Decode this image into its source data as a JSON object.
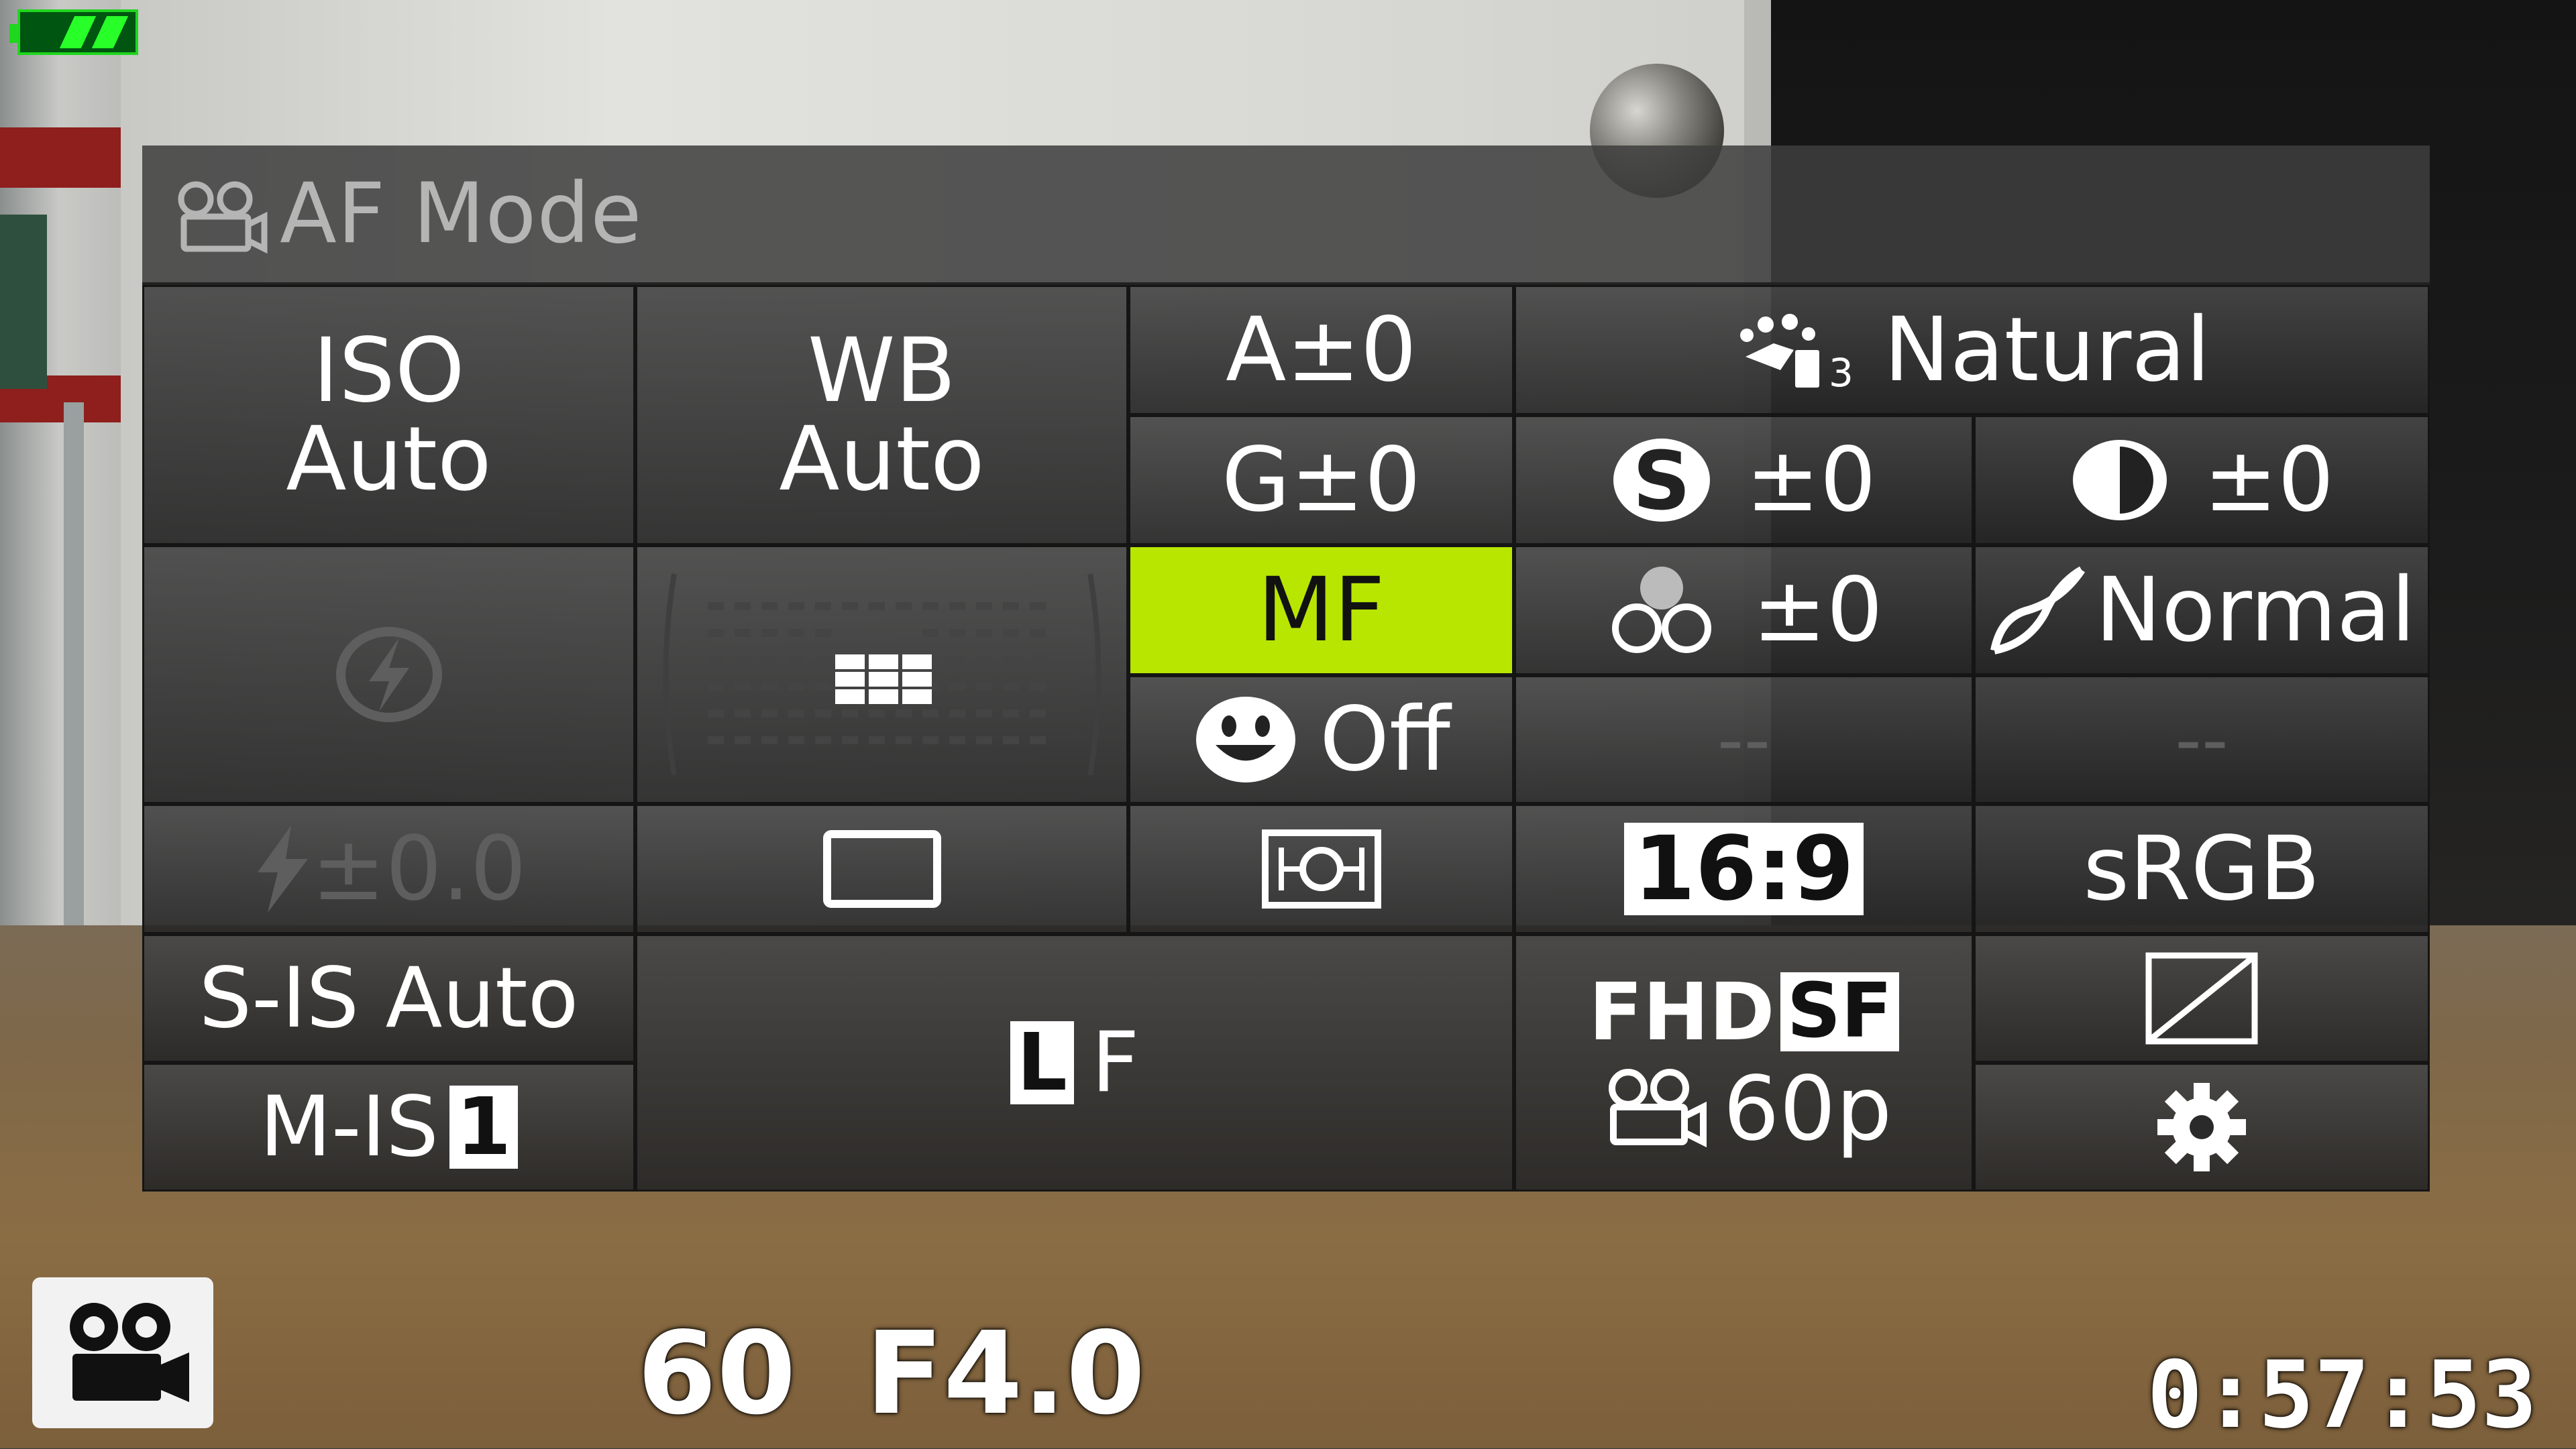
{
  "battery": {
    "level": 0.5,
    "color": "#1ed71e"
  },
  "panel": {
    "title": "AF Mode",
    "title_icon": "movie-camera-icon",
    "iso": {
      "line1": "ISO",
      "line2": "Auto"
    },
    "wb": {
      "line1": "WB",
      "line2": "Auto"
    },
    "wb_amber": "A±0",
    "wb_green": "G±0",
    "picture_mode": {
      "icon": "picture-mode-icon",
      "sub": "3",
      "label": "Natural"
    },
    "sharpness": "±0",
    "contrast": "±0",
    "saturation": "±0",
    "gradation": "Normal",
    "flash_mode_icon": "flash-off-icon",
    "af_target_icon": "af-target-grid-icon",
    "af_mode": "MF",
    "face_priority": "Off",
    "slot_empty_1": "--",
    "slot_empty_2": "--",
    "flash_comp": "±0.0",
    "drive_icon": "single-frame-icon",
    "metering_icon": "metering-icon",
    "aspect": "16:9",
    "color_space": "sRGB",
    "s_is": "S-IS Auto",
    "m_is": {
      "label": "M-IS",
      "badge": "1"
    },
    "image_quality": {
      "badge": "L",
      "label": "F"
    },
    "movie_quality": {
      "prefix": "FHD",
      "badge": "SF",
      "rate": "60p"
    },
    "shading_icon": "diagonal-box-icon",
    "settings_icon": "gear-icon",
    "selected_color": "#b8e600"
  },
  "status": {
    "mode_icon": "movie-camera-icon",
    "shutter": "60",
    "aperture": "F4.0",
    "remaining": "0:57:53"
  }
}
